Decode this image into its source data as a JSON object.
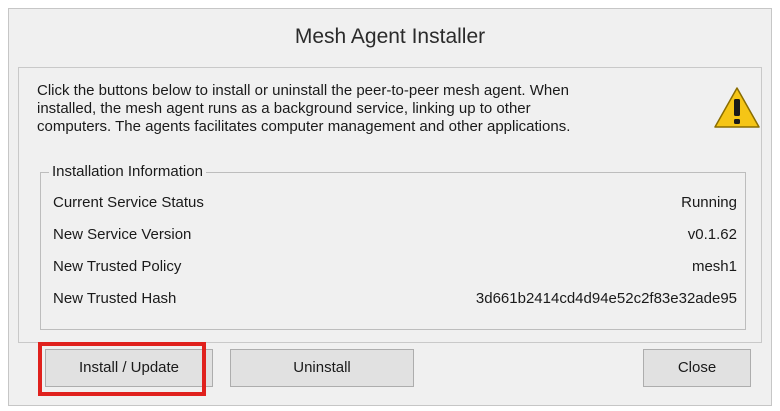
{
  "window": {
    "title": "Mesh Agent Installer"
  },
  "description": {
    "line1": "Click the buttons below to install or uninstall the peer-to-peer mesh agent. When",
    "line2": "installed, the mesh agent runs as a background service, linking up to other",
    "line3": "computers. The agents facilitates computer management and other applications."
  },
  "icons": {
    "warning": "warning-icon"
  },
  "installation_info": {
    "label": "Installation Information",
    "rows": [
      {
        "key": "Current Service Status",
        "value": "Running"
      },
      {
        "key": "New Service Version",
        "value": "v0.1.62"
      },
      {
        "key": "New Trusted Policy",
        "value": "mesh1"
      },
      {
        "key": "New Trusted Hash",
        "value": "3d661b2414cd4d94e52c2f83e32ade95"
      }
    ]
  },
  "buttons": {
    "install": "Install / Update",
    "uninstall": "Uninstall",
    "close": "Close"
  },
  "colors": {
    "highlight": "#e0211d",
    "warning_fill": "#f5c516"
  }
}
